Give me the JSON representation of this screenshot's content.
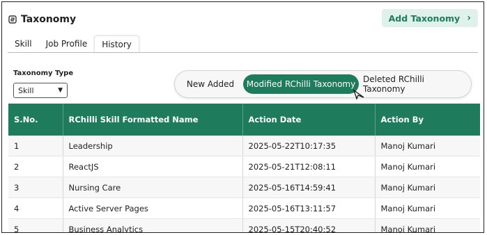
{
  "header": {
    "title": "Taxonomy",
    "add_button_label": "Add Taxonomy"
  },
  "tabs": [
    {
      "label": "Skill"
    },
    {
      "label": "Job Profile"
    },
    {
      "label": "History"
    }
  ],
  "active_tab": "History",
  "filter": {
    "label": "Taxonomy Type",
    "selected": "Skill"
  },
  "segments": [
    {
      "label": "New Added"
    },
    {
      "label": "Modified RChilli Taxonomy"
    },
    {
      "label": "Deleted RChilli Taxonomy"
    }
  ],
  "active_segment": "Modified RChilli Taxonomy",
  "table": {
    "headers": [
      "S.No.",
      "RChilli Skill Formatted Name",
      "Action Date",
      "Action By"
    ],
    "rows": [
      [
        "1",
        "Leadership",
        "2025-05-22T10:17:35",
        "Manoj Kumari"
      ],
      [
        "2",
        "ReactJS",
        "2025-05-21T12:08:11",
        "Manoj Kumari"
      ],
      [
        "3",
        "Nursing Care",
        "2025-05-16T14:59:41",
        "Manoj Kumari"
      ],
      [
        "4",
        "Active Server Pages",
        "2025-05-16T13:11:57",
        "Manoj Kumari"
      ],
      [
        "5",
        "Business Analytics",
        "2025-05-15T20:40:52",
        "Manoj Kumari"
      ]
    ]
  },
  "colors": {
    "accent": "#1e7b5b",
    "button_bg": "#dff1ea",
    "button_text": "#1b7d5c"
  },
  "icons": {
    "logo": "taxonomy-logo-icon",
    "add_chevron": "chevron-right-icon",
    "select_caret": "chevron-down-icon",
    "pointer": "mouse-cursor-icon"
  }
}
